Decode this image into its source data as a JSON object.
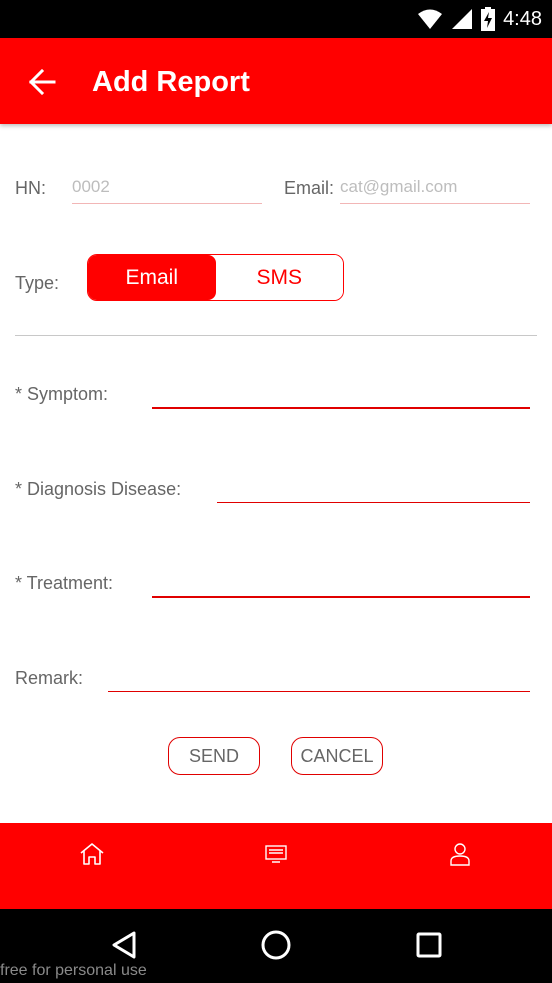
{
  "status_bar": {
    "time": "4:48",
    "icons": [
      "wifi-icon",
      "cell-signal-icon",
      "battery-charging-icon"
    ]
  },
  "app_bar": {
    "title": "Add Report",
    "back_icon": "arrow-left-icon"
  },
  "form": {
    "hn": {
      "label": "HN:",
      "placeholder": "0002",
      "value": ""
    },
    "email": {
      "label": "Email:",
      "placeholder": "cat@gmail.com",
      "value": ""
    },
    "type": {
      "label": "Type:",
      "options": [
        "Email",
        "SMS"
      ],
      "selected": "Email"
    },
    "symptom": {
      "label": "* Symptom:",
      "value": ""
    },
    "diagnosis": {
      "label": "* Diagnosis Disease:",
      "value": ""
    },
    "treatment": {
      "label": "* Treatment:",
      "value": ""
    },
    "remark": {
      "label": "Remark:",
      "value": ""
    }
  },
  "actions": {
    "send_label": "SEND",
    "cancel_label": "CANCEL"
  },
  "bottom_nav": {
    "items": [
      "home-icon",
      "report-list-icon",
      "profile-icon"
    ]
  },
  "system_nav": {
    "items": [
      "back-triangle-icon",
      "home-circle-icon",
      "recents-square-icon"
    ]
  },
  "watermark": "free for personal use",
  "colors": {
    "accent": "#ff0000",
    "status_bar": "#000000",
    "label_text": "#666666",
    "placeholder": "#bdbdbd"
  }
}
